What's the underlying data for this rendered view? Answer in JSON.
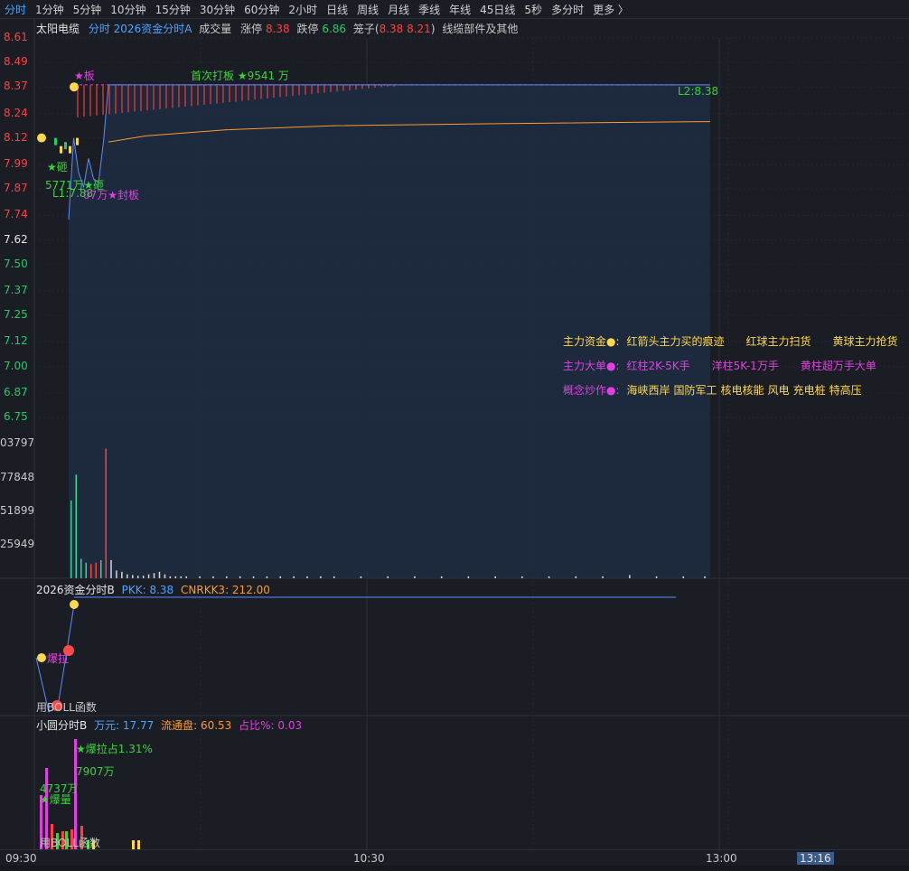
{
  "tabs": [
    {
      "label": "分时",
      "active": true
    },
    {
      "label": "1分钟"
    },
    {
      "label": "5分钟"
    },
    {
      "label": "10分钟"
    },
    {
      "label": "15分钟"
    },
    {
      "label": "30分钟"
    },
    {
      "label": "60分钟"
    },
    {
      "label": "2小时"
    },
    {
      "label": "日线"
    },
    {
      "label": "周线"
    },
    {
      "label": "月线"
    },
    {
      "label": "季线"
    },
    {
      "label": "年线"
    },
    {
      "label": "45日线"
    },
    {
      "label": "5秒"
    },
    {
      "label": "多分时"
    },
    {
      "label": "更多 〉"
    }
  ],
  "header": {
    "stock_name": "太阳电缆",
    "indicator": "分时 2026资金分时A",
    "vol_label": "成交量",
    "limit_up_label": "涨停",
    "limit_up": "8.38",
    "limit_down_label": "跌停",
    "limit_down": "6.86",
    "cage_label": "笼子(",
    "cage_values": "8.38 8.21",
    "cage_close": ")",
    "sector": "线缆部件及其他"
  },
  "price_axis": [
    "8.61",
    "8.49",
    "8.37",
    "8.24",
    "8.12",
    "7.99",
    "7.87",
    "7.74",
    "7.62",
    "7.50",
    "7.37",
    "7.25",
    "7.12",
    "7.00",
    "6.87",
    "6.75"
  ],
  "volume_axis": [
    "03797",
    "77848",
    "51899",
    "25949"
  ],
  "annotations": {
    "board_star": "★板",
    "first_board": "首次打板 ★9541 万",
    "l2": "L2:8.38",
    "smash1": "★砸",
    "smash2": "5771万★砸",
    "l1": "L1:7.88",
    "seal": "07万★封板"
  },
  "info_box": {
    "rows": [
      {
        "title": "主力资金●:",
        "items": [
          "红箭头主力买的痕迹",
          "红球主力扫货",
          "黄球主力抢货"
        ],
        "title_color": "#ffd84a",
        "item_color": "#ffd84a"
      },
      {
        "title": "主力大单●:",
        "items": [
          "红柱2K-5K手",
          "洋柱5K-1万手",
          "黄柱超万手大单"
        ],
        "title_color": "#e040e0",
        "item_color": "#e040e0"
      },
      {
        "title": "概念炒作●:",
        "items": [
          "海峡西岸",
          "国防军工",
          "核电核能",
          "风电",
          "充电桩",
          "特高压"
        ],
        "title_color": "#e040e0",
        "item_color": "#ffd84a"
      }
    ]
  },
  "panel_b": {
    "title": "2026资金分时B",
    "pkk": "PKK: 8.38",
    "cnrkk": "CNRKK3: 212.00",
    "burst": "爆拉",
    "boll": "用BOLL函数"
  },
  "panel_c": {
    "title": "小圆分时B",
    "wanyuan": "万元: 17.77",
    "float": "流通盘: 60.53",
    "ratio": "占比%: 0.03",
    "burst_ratio": "★爆拉占1.31%",
    "amount1": "7907万",
    "amount2": "4737万",
    "burst_vol": "★爆量",
    "func": "用BOLL函数"
  },
  "time_axis": [
    "09:30",
    "10:30",
    "13:00",
    "13:16"
  ],
  "colors": {
    "up": "#ff4040",
    "down": "#22cc66",
    "price_line": "#5a8cff",
    "avg_line": "#ff9a2a",
    "yellow": "#ffd84a",
    "magenta": "#e040e0",
    "green_text": "#3ad43a",
    "grid": "#2a2d36",
    "area": "#1f2e45"
  },
  "chart_data": {
    "type": "line",
    "title": "",
    "price_series": [
      {
        "t": 0,
        "p": 7.72
      },
      {
        "t": 2,
        "p": 8.12
      },
      {
        "t": 4,
        "p": 7.95
      },
      {
        "t": 6,
        "p": 7.88
      },
      {
        "t": 8,
        "p": 8.02
      },
      {
        "t": 10,
        "p": 7.92
      },
      {
        "t": 12,
        "p": 7.9
      },
      {
        "t": 14,
        "p": 8.1
      },
      {
        "t": 16,
        "p": 8.38
      },
      {
        "t": 240,
        "p": 8.38
      }
    ],
    "avg_series": [
      {
        "t": 16,
        "p": 8.1
      },
      {
        "t": 30,
        "p": 8.13
      },
      {
        "t": 60,
        "p": 8.16
      },
      {
        "t": 100,
        "p": 8.18
      },
      {
        "t": 160,
        "p": 8.19
      },
      {
        "t": 240,
        "p": 8.2
      }
    ],
    "ylim": [
      6.75,
      8.61
    ],
    "volume": [
      {
        "t": 1,
        "v": 60000,
        "c": "down"
      },
      {
        "t": 3,
        "v": 80000,
        "c": "down"
      },
      {
        "t": 5,
        "v": 15000,
        "c": "down"
      },
      {
        "t": 7,
        "v": 12000,
        "c": "down"
      },
      {
        "t": 9,
        "v": 11000,
        "c": "up"
      },
      {
        "t": 11,
        "v": 12000,
        "c": "up"
      },
      {
        "t": 13,
        "v": 14000,
        "c": "down"
      },
      {
        "t": 15,
        "v": 100000,
        "c": "up"
      },
      {
        "t": 17,
        "v": 14000,
        "c": "flat"
      },
      {
        "t": 19,
        "v": 6000,
        "c": "flat"
      },
      {
        "t": 21,
        "v": 5000,
        "c": "flat"
      },
      {
        "t": 23,
        "v": 3000,
        "c": "flat"
      },
      {
        "t": 25,
        "v": 2500,
        "c": "flat"
      },
      {
        "t": 27,
        "v": 2000,
        "c": "flat"
      },
      {
        "t": 29,
        "v": 2000,
        "c": "flat"
      },
      {
        "t": 31,
        "v": 3000,
        "c": "flat"
      },
      {
        "t": 33,
        "v": 4000,
        "c": "flat"
      },
      {
        "t": 35,
        "v": 5000,
        "c": "flat"
      },
      {
        "t": 37,
        "v": 3000,
        "c": "flat"
      },
      {
        "t": 39,
        "v": 1500,
        "c": "flat"
      },
      {
        "t": 41,
        "v": 1500,
        "c": "flat"
      },
      {
        "t": 43,
        "v": 1500,
        "c": "flat"
      },
      {
        "t": 45,
        "v": 1500,
        "c": "flat"
      },
      {
        "t": 50,
        "v": 1500,
        "c": "flat"
      },
      {
        "t": 55,
        "v": 1500,
        "c": "flat"
      },
      {
        "t": 60,
        "v": 1500,
        "c": "flat"
      },
      {
        "t": 65,
        "v": 1500,
        "c": "flat"
      },
      {
        "t": 70,
        "v": 1500,
        "c": "flat"
      },
      {
        "t": 75,
        "v": 1500,
        "c": "flat"
      },
      {
        "t": 80,
        "v": 1500,
        "c": "flat"
      },
      {
        "t": 85,
        "v": 1500,
        "c": "flat"
      },
      {
        "t": 90,
        "v": 1500,
        "c": "flat"
      },
      {
        "t": 95,
        "v": 1500,
        "c": "flat"
      },
      {
        "t": 100,
        "v": 1500,
        "c": "flat"
      },
      {
        "t": 110,
        "v": 1500,
        "c": "flat"
      },
      {
        "t": 120,
        "v": 1500,
        "c": "flat"
      },
      {
        "t": 130,
        "v": 1500,
        "c": "flat"
      },
      {
        "t": 140,
        "v": 1500,
        "c": "flat"
      },
      {
        "t": 150,
        "v": 1500,
        "c": "flat"
      },
      {
        "t": 160,
        "v": 1500,
        "c": "flat"
      },
      {
        "t": 170,
        "v": 1500,
        "c": "flat"
      },
      {
        "t": 180,
        "v": 1500,
        "c": "flat"
      },
      {
        "t": 190,
        "v": 1500,
        "c": "flat"
      },
      {
        "t": 200,
        "v": 1500,
        "c": "flat"
      },
      {
        "t": 210,
        "v": 2500,
        "c": "flat"
      },
      {
        "t": 220,
        "v": 1500,
        "c": "flat"
      },
      {
        "t": 230,
        "v": 1500,
        "c": "flat"
      },
      {
        "t": 238,
        "v": 1500,
        "c": "flat"
      }
    ],
    "vol_max": 103797
  }
}
